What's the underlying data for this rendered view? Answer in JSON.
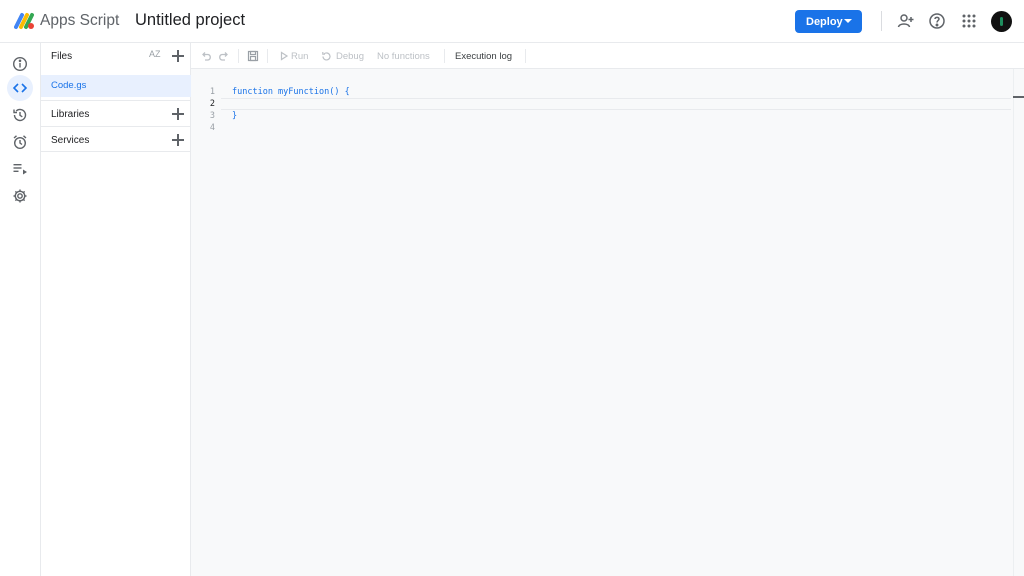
{
  "header": {
    "app_name": "Apps Script",
    "project_title": "Untitled project",
    "deploy_label": "Deploy",
    "icons": [
      "add-person-icon",
      "help-icon",
      "apps-grid-icon"
    ]
  },
  "rail": {
    "items": [
      "info-icon",
      "code-icon",
      "history-icon",
      "alarm-icon",
      "executions-icon",
      "settings-icon"
    ],
    "active": "code-icon"
  },
  "files": {
    "header": "Files",
    "sort_label": "AZ",
    "items": [
      "Code.gs"
    ],
    "libraries_label": "Libraries",
    "services_label": "Services"
  },
  "toolbar": {
    "run_label": "Run",
    "debug_label": "Debug",
    "function_select": "No functions",
    "execution_log_label": "Execution log"
  },
  "editor": {
    "line_numbers": [
      "1",
      "2",
      "3",
      "4"
    ],
    "lines": [
      "function myFunction() {",
      "",
      "}",
      ""
    ]
  },
  "colors": {
    "accent": "#1a73e8",
    "active_bg": "#e8f0fe",
    "editor_bg": "#f8f9fa"
  }
}
